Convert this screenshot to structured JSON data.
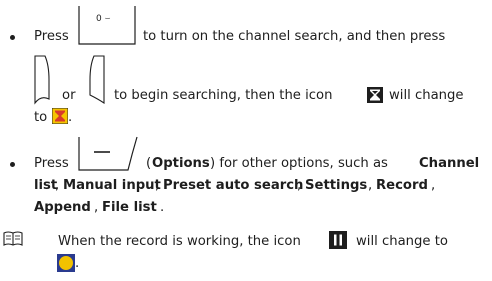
{
  "bullet1": {
    "press": "Press",
    "turn_on_text": "to turn on the channel search, and then press",
    "or": "or",
    "begin_text": "to begin searching, then the icon",
    "will_change": "will change",
    "to": "to",
    "period": ".",
    "key_label": "0 ⌣"
  },
  "bullet2": {
    "press": "Press",
    "options_open": "(",
    "options": "Options",
    "options_close": ") for other options, such as",
    "channel": "Channel",
    "list": "list",
    "comma1": ",",
    "manual_input": "Manual input",
    "comma2": ",",
    "preset_auto_search": "Preset auto search",
    "comma3": ",",
    "settings": "Settings",
    "comma4": ",",
    "record": "Record",
    "comma5": ",",
    "append": "Append",
    "comma6": ",",
    "file_list": "File list",
    "period": "."
  },
  "note": {
    "text_line1": "When the record is working, the icon",
    "will_change_to": "will change to",
    "period": "."
  },
  "colors": {
    "text": "#1e1e1e",
    "icon_dark": "#1e1e1e",
    "icon_active_fill": "#f5c400",
    "icon_active_border": "#2b2b2b",
    "record_active": "#f2c200"
  },
  "icons": {
    "zero_key": "zero-key-icon",
    "up_key": "up-side-key-icon",
    "down_key": "down-side-key-icon",
    "search_icon": "hourglass-search-icon",
    "search_icon_active": "hourglass-search-active-icon",
    "options_key": "left-soft-key-icon",
    "note_icon": "book-note-icon",
    "pause_icon": "pause-icon",
    "record_active_icon": "record-circle-icon"
  }
}
